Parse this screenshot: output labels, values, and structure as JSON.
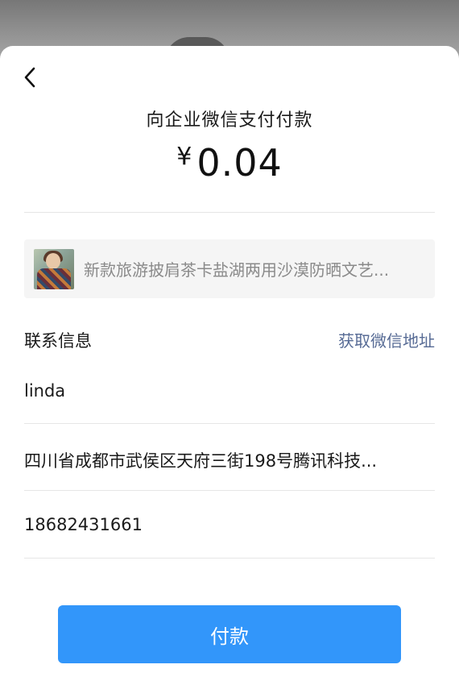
{
  "header": {
    "back_icon": "chevron-left-icon",
    "title": "向企业微信支付付款"
  },
  "payment": {
    "currency_symbol": "¥",
    "amount": "0.04"
  },
  "product": {
    "thumbnail": "product-thumbnail-image",
    "name": "新款旅游披肩茶卡盐湖两用沙漠防晒文艺..."
  },
  "contact": {
    "label": "联系信息",
    "fetch_address_link": "获取微信地址",
    "name": "linda",
    "address": "四川省成都市武侯区天府三街198号腾讯科技...",
    "phone": "18682431661"
  },
  "action": {
    "pay_label": "付款"
  },
  "colors": {
    "primary_button": "#3296fa",
    "link": "#576b95"
  }
}
